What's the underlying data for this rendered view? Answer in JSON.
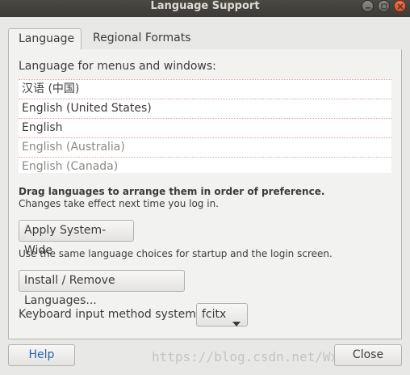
{
  "window": {
    "title": "Language Support",
    "controls": {
      "minimize": "minimize-icon",
      "maximize": "maximize-icon",
      "close": "close-icon"
    }
  },
  "tabs": [
    {
      "label": "Language",
      "active": true
    },
    {
      "label": "Regional Formats",
      "active": false
    }
  ],
  "language_panel": {
    "heading": "Language for menus and windows:",
    "languages": [
      {
        "label": "汉语 (中国)",
        "dim": false
      },
      {
        "label": "English (United States)",
        "dim": false
      },
      {
        "label": "English",
        "dim": false
      },
      {
        "label": "English (Australia)",
        "dim": true
      },
      {
        "label": "English (Canada)",
        "dim": true
      }
    ],
    "hint_bold": "Drag languages to arrange them in order of preference.",
    "hint": "Changes take effect next time you log in.",
    "apply_button": "Apply System-Wide",
    "apply_desc": "Use the same language choices for startup and the login screen.",
    "install_button": "Install / Remove Languages...",
    "keyboard_label": "Keyboard input method system:",
    "keyboard_value": "fcitx"
  },
  "footer": {
    "help_button": "Help",
    "close_button": "Close"
  },
  "watermark": "https://blog.csdn.net/Wxx_combo",
  "colors": {
    "titlebar": "#3c3b37",
    "close_control": "#e2592f",
    "help_text": "#2a62b0",
    "list_divider": "#d6a397"
  }
}
